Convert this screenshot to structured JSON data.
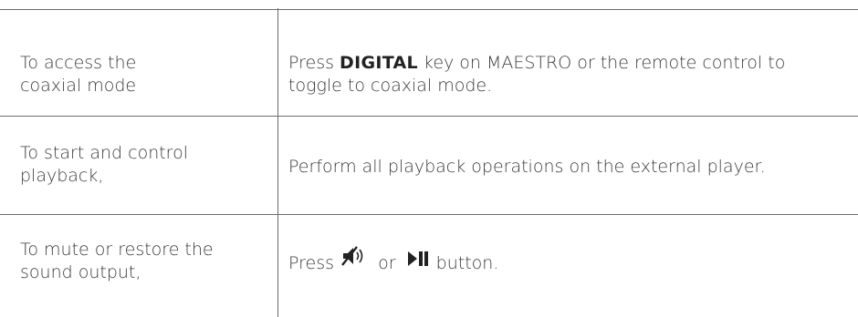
{
  "rows": [
    {
      "label": "To access the coaxial mode",
      "label_lines": [
        "To access the",
        "coaxial mode"
      ],
      "action_prefix": "Press ",
      "action_key": "DIGITAL",
      "action_suffix_line1": " key on MAESTRO or the remote control to",
      "action_line2": "toggle to coaxial mode."
    },
    {
      "label_lines": [
        "To start and control",
        "playback,"
      ],
      "action": "Perform all playback operations on the external player."
    },
    {
      "label_lines": [
        "To mute or restore the",
        "sound output,"
      ],
      "action_prefix": "Press",
      "action_middle": "or",
      "action_suffix": "button.",
      "icons": [
        "mute-icon",
        "play-pause-icon"
      ]
    }
  ]
}
